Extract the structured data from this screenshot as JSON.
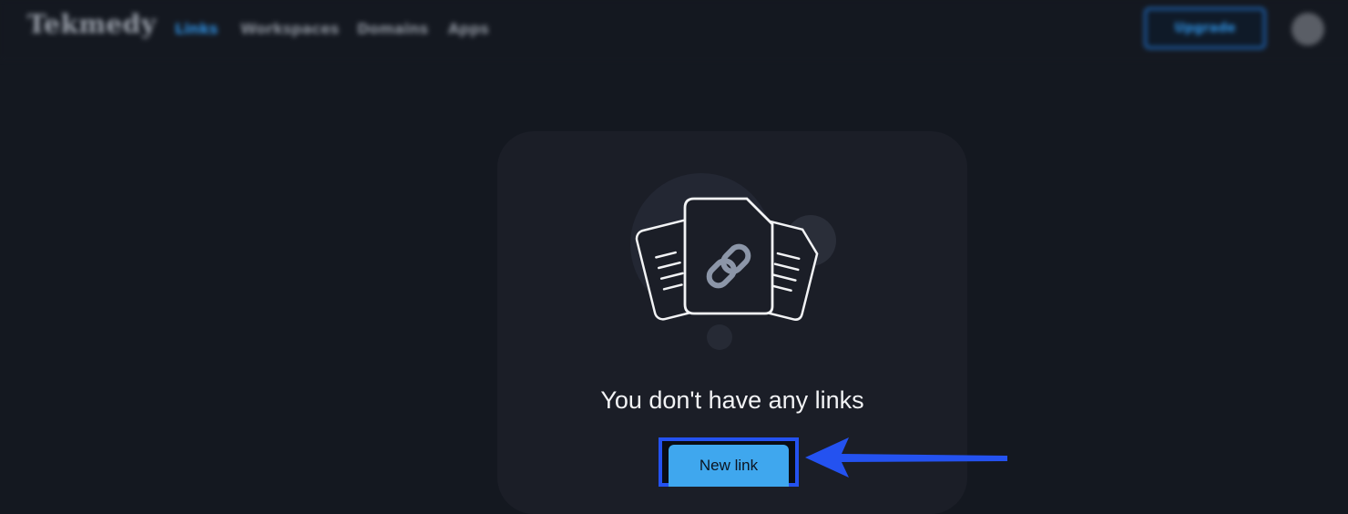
{
  "header": {
    "logo_text": "Tekmedy",
    "nav": [
      {
        "label": "Links",
        "active": true
      },
      {
        "label": "Workspaces",
        "active": false
      },
      {
        "label": "Domains",
        "active": false
      },
      {
        "label": "Apps",
        "active": false
      }
    ],
    "upgrade_label": "Upgrade"
  },
  "empty_state": {
    "title": "You don't have any links",
    "button_label": "New link",
    "illustration_icon": "link-documents-icon"
  },
  "colors": {
    "background": "#141820",
    "card": "#1b1e27",
    "accent": "#3fa7ee",
    "annotation": "#2452f0"
  }
}
